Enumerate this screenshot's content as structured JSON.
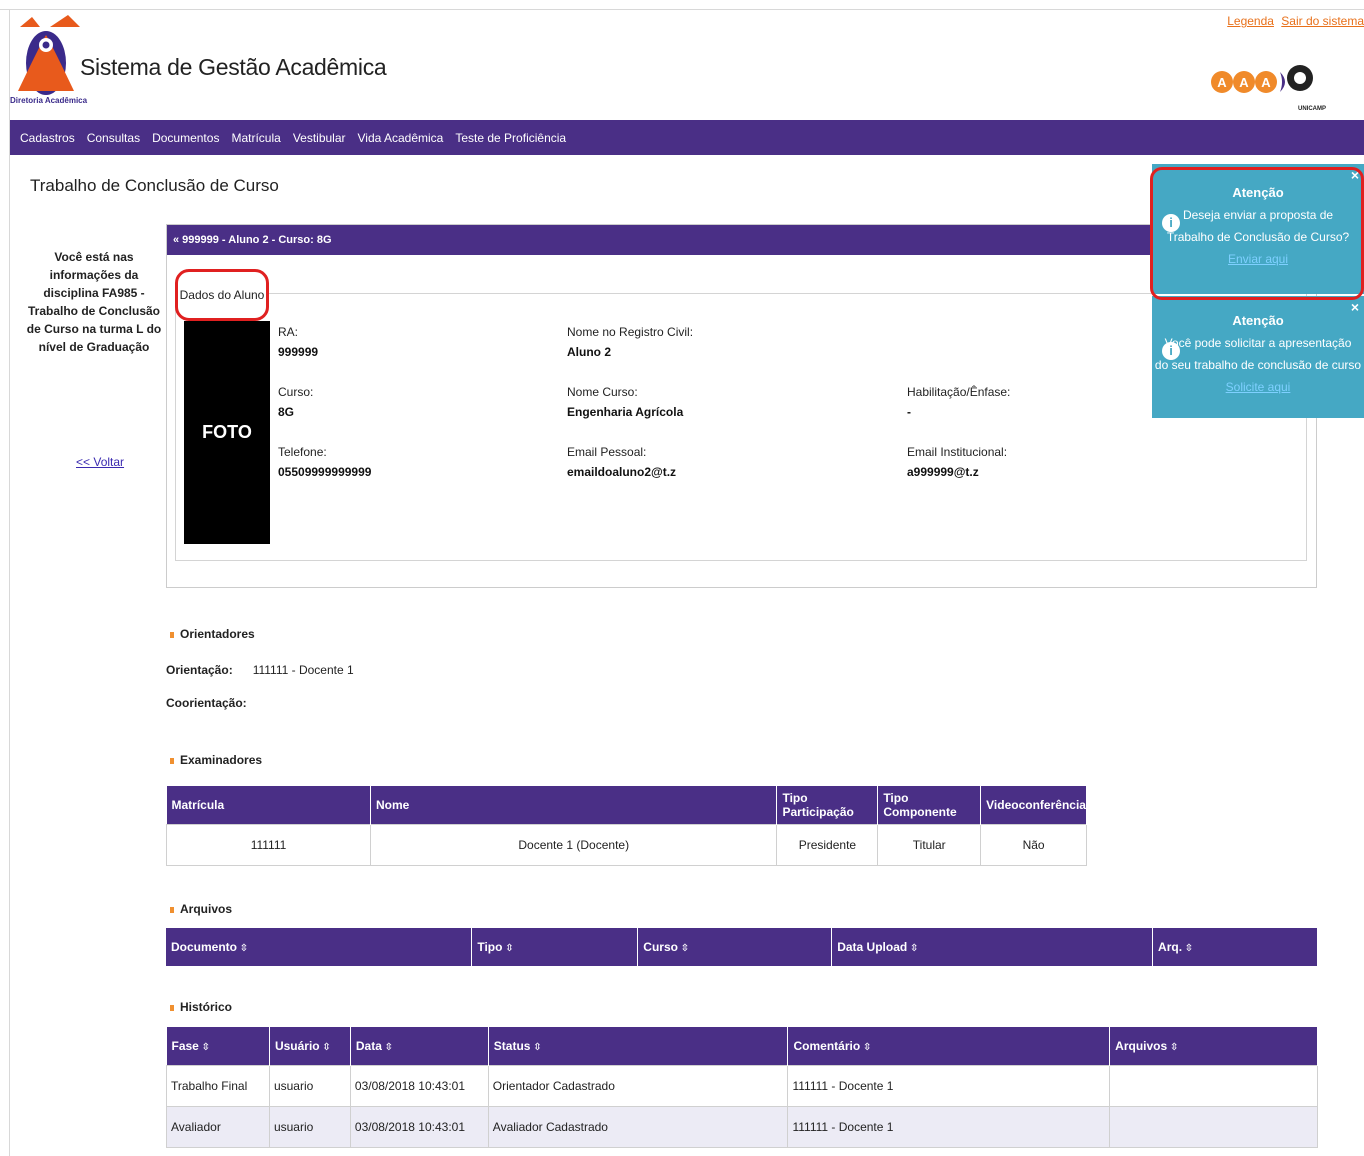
{
  "header": {
    "app_title": "Sistema de Gestão Acadêmica",
    "logo_sub": "Diretoria Acadêmica",
    "link_legenda": "Legenda",
    "link_sair": "Sair do sistema",
    "unicamp": "UNICAMP"
  },
  "nav": [
    "Cadastros",
    "Consultas",
    "Documentos",
    "Matrícula",
    "Vestibular",
    "Vida Acadêmica",
    "Teste de Proficiência"
  ],
  "page_title": "Trabalho de Conclusão de Curso",
  "side_info": "Você está nas informações da disciplina FA985 - Trabalho de Conclusão de Curso na turma L do nível de Graduação",
  "back": "<< Voltar",
  "student_bar": "« 999999 - Aluno 2 - Curso: 8G",
  "legend": "Dados do Aluno",
  "photo": "FOTO",
  "fields": {
    "ra_label": "RA:",
    "ra": "999999",
    "nome_label": "Nome no Registro Civil:",
    "nome": "Aluno 2",
    "curso_label": "Curso:",
    "curso": "8G",
    "nome_curso_label": "Nome Curso:",
    "nome_curso": "Engenharia Agrícola",
    "hab_label": "Habilitação/Ênfase:",
    "hab": "-",
    "tel_label": "Telefone:",
    "tel": "05509999999999",
    "email_pessoal_label": "Email Pessoal:",
    "email_pessoal": "emaildoaluno2@t.z",
    "email_inst_label": "Email Institucional:",
    "email_inst": "a999999@t.z"
  },
  "orientadores": {
    "title": "Orientadores",
    "orientacao_label": "Orientação:",
    "orientacao": "111111 - Docente 1",
    "coorientacao_label": "Coorientação:"
  },
  "examinadores": {
    "title": "Examinadores",
    "headers": [
      "Matrícula",
      "Nome",
      "Tipo Participação",
      "Tipo Componente",
      "Videoconferência"
    ],
    "row": [
      "111111",
      "Docente 1 (Docente)",
      "Presidente",
      "Titular",
      "Não"
    ]
  },
  "arquivos": {
    "title": "Arquivos",
    "headers": [
      "Documento",
      "Tipo",
      "Curso",
      "Data Upload",
      "Arq."
    ]
  },
  "historico": {
    "title": "Histórico",
    "headers": [
      "Fase",
      "Usuário",
      "Data",
      "Status",
      "Comentário",
      "Arquivos"
    ],
    "rows": [
      [
        "Trabalho Final",
        "usuario",
        "03/08/2018 10:43:01",
        "Orientador Cadastrado",
        "111111 - Docente 1",
        ""
      ],
      [
        "Avaliador",
        "usuario",
        "03/08/2018 10:43:01",
        "Avaliador Cadastrado",
        "111111 - Docente 1",
        ""
      ]
    ]
  },
  "toasts": [
    {
      "title": "Atenção",
      "line1": "Deseja enviar a proposta de",
      "line2": "Trabalho de Conclusão de Curso?",
      "link": "Enviar aqui"
    },
    {
      "title": "Atenção",
      "line1": "Você pode solicitar a apresentação",
      "line2": "do seu trabalho de conclusão de curso",
      "link": "Solicite aqui"
    }
  ],
  "colors": {
    "nav": "#4a2f86",
    "toast": "#45a8c4",
    "highlight": "#e02020",
    "accent": "#f09030"
  }
}
